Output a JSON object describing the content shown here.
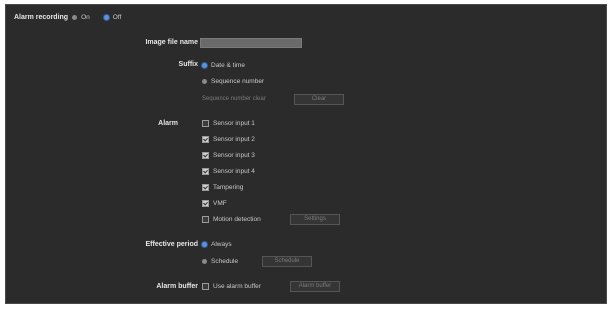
{
  "alarm_recording": {
    "label": "Alarm recording",
    "on_label": "On",
    "off_label": "Off",
    "selected": "Off"
  },
  "image_file_name": {
    "label": "Image file name",
    "value": ""
  },
  "suffix": {
    "label": "Suffix",
    "options": [
      {
        "label": "Date & time",
        "selected": true
      },
      {
        "label": "Sequence number",
        "selected": false
      }
    ],
    "sequence_clear_label": "Sequence number clear",
    "clear_button": "Clear"
  },
  "alarm": {
    "label": "Alarm",
    "items": [
      {
        "label": "Sensor input 1",
        "checked": false
      },
      {
        "label": "Sensor input 2",
        "checked": true
      },
      {
        "label": "Sensor input 3",
        "checked": true
      },
      {
        "label": "Sensor input 4",
        "checked": true
      },
      {
        "label": "Tampering",
        "checked": true
      },
      {
        "label": "VMF",
        "checked": true
      },
      {
        "label": "Motion detection",
        "checked": false
      }
    ],
    "settings_button": "Settings"
  },
  "effective_period": {
    "label": "Effective period",
    "options": [
      {
        "label": "Always",
        "selected": true
      },
      {
        "label": "Schedule",
        "selected": false
      }
    ],
    "schedule_button": "Schedule"
  },
  "alarm_buffer": {
    "label": "Alarm buffer",
    "checkbox_label": "Use alarm buffer",
    "checked": false,
    "settings_button": "Alarm buffer"
  }
}
